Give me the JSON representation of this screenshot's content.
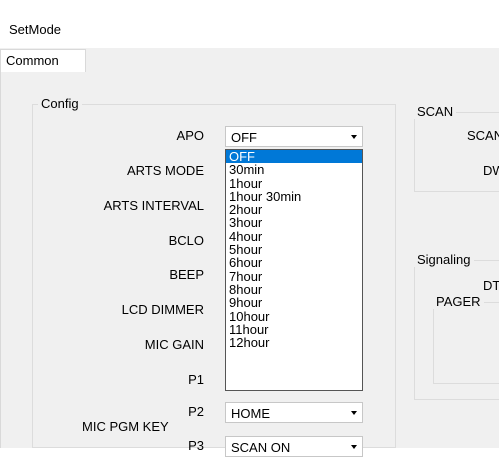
{
  "window": {
    "title": "SetMode"
  },
  "tabs": [
    {
      "label": "Common"
    }
  ],
  "config": {
    "legend": "Config",
    "labels": [
      "APO",
      "ARTS MODE",
      "ARTS INTERVAL",
      "BCLO",
      "BEEP",
      "LCD DIMMER",
      "MIC GAIN",
      "P1",
      "P2",
      "MIC PGM KEY",
      "P3"
    ],
    "apo_value": "OFF",
    "p2_value": "HOME",
    "p3_value": "SCAN ON",
    "apo_options": [
      "OFF",
      "30min",
      "1hour",
      "1hour 30min",
      "2hour",
      "3hour",
      "4hour",
      "5hour",
      "6hour",
      "7hour",
      "8hour",
      "9hour",
      "10hour",
      "11hour",
      "12hour"
    ],
    "apo_selected_index": 0
  },
  "scan": {
    "legend": "SCAN",
    "labels": [
      "SCAN",
      "DW"
    ]
  },
  "signaling": {
    "legend": "Signaling",
    "labels": [
      "DT"
    ],
    "pager_legend": "PAGER"
  }
}
